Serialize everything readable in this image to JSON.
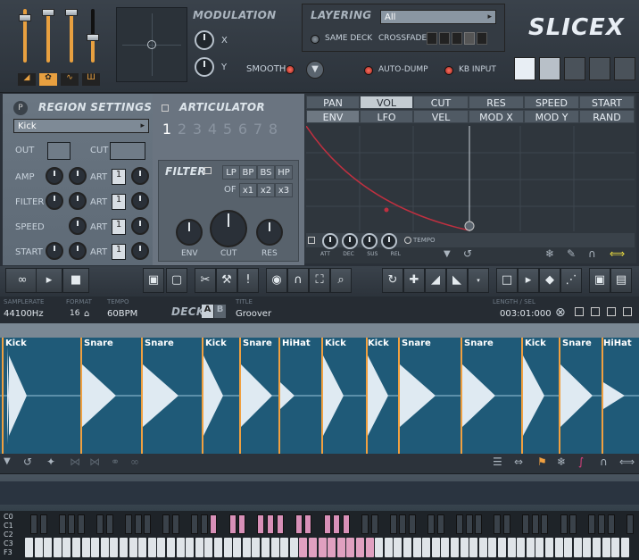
{
  "modulation": {
    "title": "MODULATION",
    "x_label": "X",
    "y_label": "Y",
    "smooth_label": "SMOOTH"
  },
  "layering": {
    "title": "LAYERING",
    "select_value": "All",
    "same_deck": "SAME DECK",
    "crossfade": "CROSSFADE",
    "auto_dump": "AUTO-DUMP",
    "kb_input": "KB INPUT"
  },
  "logo": "SLICEX",
  "region": {
    "title": "REGION SETTINGS",
    "select_value": "Kick",
    "out": "OUT",
    "cut": "CUT",
    "amp": "AMP",
    "filter": "FILTER",
    "speed": "SPEED",
    "start": "START",
    "art": "ART",
    "art_values": [
      "1",
      "1",
      "1",
      "1"
    ]
  },
  "articulator": {
    "title": "ARTICULATOR",
    "numbers": [
      "1",
      "2",
      "3",
      "4",
      "5",
      "6",
      "7",
      "8"
    ]
  },
  "filter": {
    "title": "FILTER",
    "types": [
      "LP",
      "BP",
      "BS",
      "HP"
    ],
    "of": "OF",
    "mult": [
      "x1",
      "x2",
      "x3"
    ],
    "env": "ENV",
    "cut": "CUT",
    "res": "RES"
  },
  "env_tabs": {
    "row1": [
      "PAN",
      "VOL",
      "CUT",
      "RES",
      "SPEED",
      "START"
    ],
    "row2": [
      "ENV",
      "LFO",
      "VEL",
      "MOD X",
      "MOD Y",
      "RAND"
    ],
    "knobs": [
      "ATT",
      "DEC",
      "SUS",
      "REL"
    ],
    "tempo": "TEMPO"
  },
  "info": {
    "samplerate_label": "SAMPLERATE",
    "samplerate": "44100Hz",
    "format_label": "FORMAT",
    "format": "16",
    "tempo_label": "TEMPO",
    "tempo": "60BPM",
    "deck_label": "DECK",
    "deck_a": "A",
    "deck_b": "B",
    "title_label": "TITLE",
    "title": "Groover",
    "length_label": "LENGTH / SEL",
    "length": "003:01:000"
  },
  "slices": [
    "Kick",
    "Snare",
    "Snare",
    "Kick",
    "Snare",
    "HiHat",
    "Kick",
    "Kick",
    "Snare",
    "Snare",
    "Kick",
    "Snare",
    "HiHat"
  ],
  "keyboard": {
    "octaves": [
      "C0",
      "C1",
      "C2",
      "C3",
      "F3"
    ]
  },
  "colors": {
    "accent": "#f0a040",
    "envelope": "#c03040",
    "wave_bg": "#1f5a78"
  }
}
